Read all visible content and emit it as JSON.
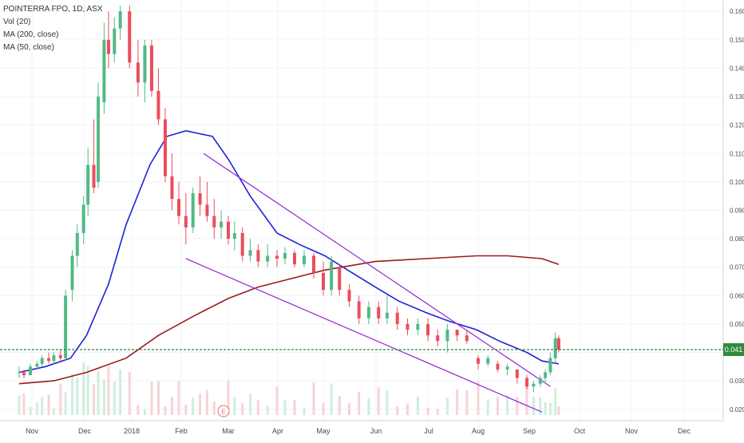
{
  "legend": {
    "symbol": "POINTERRA FPO, 1D, ASX",
    "vol": "Vol (20)",
    "ma200": "MA (200, close)",
    "ma50": "MA (50, close)"
  },
  "price_axis": {
    "ticks": [
      "0.160",
      "0.150",
      "0.140",
      "0.130",
      "0.120",
      "0.110",
      "0.100",
      "0.090",
      "0.080",
      "0.070",
      "0.060",
      "0.050",
      "0.040",
      "0.030",
      "0.020"
    ],
    "last_price_label": "0.041"
  },
  "time_axis": {
    "ticks": [
      "Nov",
      "Dec",
      "2018",
      "Feb",
      "Mar",
      "Apr",
      "May",
      "Jun",
      "Jul",
      "Aug",
      "Sep",
      "Oct",
      "Nov",
      "Dec"
    ]
  },
  "earnings_marker": "E",
  "colors": {
    "up": "#53b987",
    "down": "#eb4d5c",
    "ma50": "#1e22d6",
    "ma200": "#9c1b1b",
    "trend": "#9b30d9",
    "last_price": "#2e8b3a",
    "vol_ma": "#f4a46c"
  },
  "chart_data": {
    "type": "candlestick",
    "title": "POINTERRA FPO, 1D, ASX",
    "ylim": [
      0.016,
      0.164
    ],
    "last_price": 0.041,
    "series": [
      {
        "name": "MA (50, close)",
        "points": [
          [
            "Oct 25",
            0.033
          ],
          [
            "Nov 10",
            0.035
          ],
          [
            "Nov 25",
            0.038
          ],
          [
            "Dec 5",
            0.046
          ],
          [
            "Dec 20",
            0.064
          ],
          [
            "Jan 1",
            0.085
          ],
          [
            "Jan 15",
            0.106
          ],
          [
            "Jan 25",
            0.116
          ],
          [
            "Feb 5",
            0.118
          ],
          [
            "Feb 20",
            0.116
          ],
          [
            "Mar 1",
            0.108
          ],
          [
            "Mar 15",
            0.095
          ],
          [
            "Apr 1",
            0.082
          ],
          [
            "Apr 15",
            0.078
          ],
          [
            "May 1",
            0.074
          ],
          [
            "May 15",
            0.069
          ],
          [
            "Jun 1",
            0.063
          ],
          [
            "Jun 15",
            0.058
          ],
          [
            "Jul 1",
            0.054
          ],
          [
            "Jul 15",
            0.051
          ],
          [
            "Aug 1",
            0.048
          ],
          [
            "Aug 15",
            0.044
          ],
          [
            "Sep 1",
            0.04
          ],
          [
            "Sep 10",
            0.037
          ],
          [
            "Sep 20",
            0.036
          ]
        ]
      },
      {
        "name": "MA (200, close)",
        "points": [
          [
            "Oct 25",
            0.029
          ],
          [
            "Nov 15",
            0.03
          ],
          [
            "Dec 5",
            0.033
          ],
          [
            "Jan 1",
            0.038
          ],
          [
            "Jan 20",
            0.046
          ],
          [
            "Feb 10",
            0.053
          ],
          [
            "Mar 1",
            0.059
          ],
          [
            "Mar 20",
            0.063
          ],
          [
            "Apr 10",
            0.066
          ],
          [
            "May 1",
            0.069
          ],
          [
            "Jun 1",
            0.072
          ],
          [
            "Jul 1",
            0.073
          ],
          [
            "Aug 1",
            0.074
          ],
          [
            "Aug 20",
            0.074
          ],
          [
            "Sep 10",
            0.073
          ],
          [
            "Sep 20",
            0.071
          ]
        ]
      }
    ],
    "trend_lines": [
      {
        "from": [
          "Feb 15",
          0.11
        ],
        "to": [
          "Sep 15",
          0.028
        ]
      },
      {
        "from": [
          "Feb 5",
          0.073
        ],
        "to": [
          "Sep 10",
          0.019
        ]
      }
    ],
    "candles": [
      [
        "Oct 25",
        0.033,
        0.035,
        0.031,
        0.033
      ],
      [
        "Oct 28",
        0.033,
        0.034,
        0.031,
        0.032
      ],
      [
        "Nov 1",
        0.032,
        0.036,
        0.032,
        0.035
      ],
      [
        "Nov 5",
        0.035,
        0.037,
        0.034,
        0.036
      ],
      [
        "Nov 8",
        0.036,
        0.039,
        0.035,
        0.038
      ],
      [
        "Nov 12",
        0.038,
        0.04,
        0.036,
        0.037
      ],
      [
        "Nov 15",
        0.037,
        0.04,
        0.036,
        0.039
      ],
      [
        "Nov 19",
        0.039,
        0.041,
        0.037,
        0.038
      ],
      [
        "Nov 22",
        0.038,
        0.062,
        0.037,
        0.06
      ],
      [
        "Nov 26",
        0.062,
        0.076,
        0.058,
        0.074
      ],
      [
        "Nov 29",
        0.074,
        0.085,
        0.07,
        0.082
      ],
      [
        "Dec 3",
        0.082,
        0.095,
        0.078,
        0.092
      ],
      [
        "Dec 6",
        0.092,
        0.112,
        0.088,
        0.106
      ],
      [
        "Dec 10",
        0.106,
        0.122,
        0.096,
        0.098
      ],
      [
        "Dec 13",
        0.1,
        0.135,
        0.098,
        0.13
      ],
      [
        "Dec 17",
        0.128,
        0.156,
        0.124,
        0.15
      ],
      [
        "Dec 20",
        0.15,
        0.16,
        0.14,
        0.145
      ],
      [
        "Dec 24",
        0.145,
        0.158,
        0.142,
        0.154
      ],
      [
        "Dec 28",
        0.154,
        0.162,
        0.15,
        0.16
      ],
      [
        "Jan 3",
        0.16,
        0.162,
        0.14,
        0.142
      ],
      [
        "Jan 8",
        0.142,
        0.15,
        0.13,
        0.135
      ],
      [
        "Jan 12",
        0.135,
        0.15,
        0.128,
        0.148
      ],
      [
        "Jan 16",
        0.148,
        0.15,
        0.13,
        0.132
      ],
      [
        "Jan 20",
        0.132,
        0.14,
        0.12,
        0.122
      ],
      [
        "Jan 24",
        0.122,
        0.126,
        0.1,
        0.102
      ],
      [
        "Jan 28",
        0.102,
        0.11,
        0.09,
        0.094
      ],
      [
        "Feb 1",
        0.094,
        0.1,
        0.085,
        0.088
      ],
      [
        "Feb 5",
        0.088,
        0.096,
        0.078,
        0.084
      ],
      [
        "Feb 9",
        0.084,
        0.098,
        0.082,
        0.096
      ],
      [
        "Feb 13",
        0.096,
        0.102,
        0.088,
        0.092
      ],
      [
        "Feb 17",
        0.092,
        0.1,
        0.086,
        0.088
      ],
      [
        "Feb 21",
        0.088,
        0.094,
        0.08,
        0.084
      ],
      [
        "Feb 25",
        0.084,
        0.09,
        0.08,
        0.086
      ],
      [
        "Mar 1",
        0.086,
        0.088,
        0.078,
        0.08
      ],
      [
        "Mar 5",
        0.08,
        0.086,
        0.076,
        0.082
      ],
      [
        "Mar 10",
        0.082,
        0.084,
        0.072,
        0.074
      ],
      [
        "Mar 15",
        0.074,
        0.08,
        0.072,
        0.076
      ],
      [
        "Mar 20",
        0.076,
        0.078,
        0.07,
        0.072
      ],
      [
        "Mar 26",
        0.072,
        0.078,
        0.07,
        0.074
      ],
      [
        "Apr 1",
        0.074,
        0.076,
        0.07,
        0.073
      ],
      [
        "Apr 6",
        0.073,
        0.077,
        0.071,
        0.075
      ],
      [
        "Apr 12",
        0.075,
        0.076,
        0.07,
        0.071
      ],
      [
        "Apr 18",
        0.071,
        0.076,
        0.07,
        0.074
      ],
      [
        "Apr 24",
        0.074,
        0.075,
        0.066,
        0.068
      ],
      [
        "Apr 30",
        0.068,
        0.072,
        0.06,
        0.062
      ],
      [
        "May 5",
        0.062,
        0.074,
        0.06,
        0.072
      ],
      [
        "May 10",
        0.07,
        0.071,
        0.06,
        0.062
      ],
      [
        "May 16",
        0.062,
        0.064,
        0.056,
        0.058
      ],
      [
        "May 22",
        0.058,
        0.06,
        0.05,
        0.052
      ],
      [
        "May 28",
        0.052,
        0.058,
        0.05,
        0.056
      ],
      [
        "Jun 3",
        0.056,
        0.058,
        0.05,
        0.052
      ],
      [
        "Jun 8",
        0.052,
        0.06,
        0.05,
        0.054
      ],
      [
        "Jun 14",
        0.054,
        0.056,
        0.048,
        0.05
      ],
      [
        "Jun 20",
        0.05,
        0.052,
        0.046,
        0.048
      ],
      [
        "Jun 26",
        0.048,
        0.052,
        0.046,
        0.05
      ],
      [
        "Jul 2",
        0.05,
        0.052,
        0.044,
        0.046
      ],
      [
        "Jul 8",
        0.046,
        0.048,
        0.042,
        0.044
      ],
      [
        "Jul 14",
        0.044,
        0.05,
        0.04,
        0.048
      ],
      [
        "Jul 20",
        0.048,
        0.048,
        0.044,
        0.046
      ],
      [
        "Jul 26",
        0.046,
        0.048,
        0.043,
        0.044
      ],
      [
        "Aug 2",
        0.038,
        0.039,
        0.034,
        0.036
      ],
      [
        "Aug 8",
        0.036,
        0.039,
        0.035,
        0.038
      ],
      [
        "Aug 14",
        0.036,
        0.037,
        0.033,
        0.034
      ],
      [
        "Aug 20",
        0.034,
        0.036,
        0.032,
        0.035
      ],
      [
        "Aug 26",
        0.034,
        0.034,
        0.029,
        0.031
      ],
      [
        "Sep 1",
        0.031,
        0.032,
        0.027,
        0.028
      ],
      [
        "Sep 5",
        0.028,
        0.03,
        0.026,
        0.029
      ],
      [
        "Sep 9",
        0.029,
        0.032,
        0.028,
        0.031
      ],
      [
        "Sep 12",
        0.031,
        0.034,
        0.029,
        0.033
      ],
      [
        "Sep 15",
        0.033,
        0.04,
        0.032,
        0.038
      ],
      [
        "Sep 18",
        0.038,
        0.047,
        0.036,
        0.045
      ],
      [
        "Sep 20",
        0.045,
        0.046,
        0.04,
        0.041
      ]
    ]
  }
}
